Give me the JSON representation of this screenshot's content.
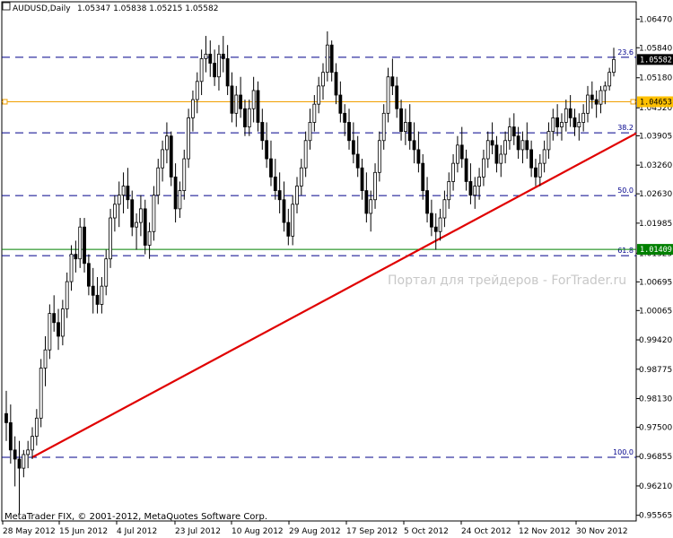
{
  "header": {
    "symbol": "AUDUSD,Daily",
    "ohlc": "1.05347 1.05838 1.05215 1.05582"
  },
  "watermark": "Портал для трейдеров - ForTrader.ru",
  "copyright": "MetaTrader FIX, © 2001-2012, MetaQuotes Software Corp.",
  "colors": {
    "background": "#ffffff",
    "candles": "#000000",
    "fib_lines": "#00008b",
    "trendline": "#e00000",
    "orange_line": "#f0a000",
    "green_line": "#008000"
  },
  "chart_data": {
    "type": "candlestick",
    "symbol": "AUDUSD",
    "timeframe": "Daily",
    "last_bar": {
      "open": 1.05347,
      "high": 1.05838,
      "low": 1.05215,
      "close": 1.05582
    },
    "ylim": [
      0.9544,
      1.0685
    ],
    "y_ticks": [
      "1.06470",
      "1.05840",
      "1.05180",
      "1.04520",
      "1.03905",
      "1.03260",
      "1.02630",
      "1.01985",
      "1.01325",
      "1.00695",
      "1.00065",
      "0.99420",
      "0.98775",
      "0.98130",
      "0.97500",
      "0.96855",
      "0.96210",
      "0.95565"
    ],
    "x_ticks": [
      "28 May 2012",
      "15 Jun 2012",
      "4 Jul 2012",
      "23 Jul 2012",
      "10 Aug 2012",
      "29 Aug 2012",
      "17 Sep 2012",
      "5 Oct 2012",
      "24 Oct 2012",
      "12 Nov 2012",
      "30 Nov 2012"
    ],
    "fib_levels": [
      {
        "label": "23.6",
        "price": 1.0563
      },
      {
        "label": "38.2",
        "price": 1.0397
      },
      {
        "label": "50.0",
        "price": 1.0259
      },
      {
        "label": "61.8",
        "price": 1.0127
      },
      {
        "label": "100.0",
        "price": 0.9684
      }
    ],
    "price_lines": [
      {
        "price": 1.04653,
        "label": "1.04653",
        "color": "#f0a000",
        "badge_bg": "#ffc000"
      },
      {
        "price": 1.01409,
        "label": "1.01409",
        "color": "#008000",
        "badge_bg": "#008000"
      },
      {
        "price": 1.05582,
        "label": "1.05582",
        "color": "#000000",
        "badge_bg": "#000000"
      }
    ],
    "trendline": {
      "from": {
        "bar": 6,
        "price": 0.9684
      },
      "to": {
        "bar": 144,
        "price": 1.039
      }
    },
    "bars": [
      [
        0.978,
        0.983,
        0.972,
        0.976
      ],
      [
        0.976,
        0.98,
        0.967,
        0.97
      ],
      [
        0.97,
        0.973,
        0.962,
        0.968
      ],
      [
        0.968,
        0.972,
        0.956,
        0.966
      ],
      [
        0.966,
        0.97,
        0.964,
        0.969
      ],
      [
        0.969,
        0.972,
        0.966,
        0.97
      ],
      [
        0.97,
        0.975,
        0.968,
        0.973
      ],
      [
        0.973,
        0.979,
        0.971,
        0.977
      ],
      [
        0.977,
        0.99,
        0.975,
        0.988
      ],
      [
        0.988,
        0.995,
        0.984,
        0.992
      ],
      [
        0.992,
        1.002,
        0.99,
        1.0
      ],
      [
        1.0,
        1.004,
        0.996,
        0.998
      ],
      [
        0.998,
        1.001,
        0.992,
        0.995
      ],
      [
        0.995,
        1.003,
        0.993,
        1.001
      ],
      [
        1.001,
        1.009,
        0.999,
        1.007
      ],
      [
        1.007,
        1.015,
        1.005,
        1.013
      ],
      [
        1.013,
        1.016,
        1.009,
        1.012
      ],
      [
        1.012,
        1.021,
        1.01,
        1.019
      ],
      [
        1.019,
        1.021,
        1.009,
        1.011
      ],
      [
        1.011,
        1.013,
        1.004,
        1.006
      ],
      [
        1.006,
        1.01,
        1.0,
        1.004
      ],
      [
        1.004,
        1.008,
        1.0,
        1.002
      ],
      [
        1.002,
        1.008,
        1.0,
        1.006
      ],
      [
        1.006,
        1.014,
        1.004,
        1.012
      ],
      [
        1.012,
        1.023,
        1.01,
        1.021
      ],
      [
        1.021,
        1.026,
        1.018,
        1.024
      ],
      [
        1.024,
        1.029,
        1.019,
        1.026
      ],
      [
        1.026,
        1.031,
        1.022,
        1.028
      ],
      [
        1.028,
        1.032,
        1.023,
        1.025
      ],
      [
        1.025,
        1.027,
        1.017,
        1.019
      ],
      [
        1.019,
        1.022,
        1.014,
        1.02
      ],
      [
        1.02,
        1.026,
        1.017,
        1.023
      ],
      [
        1.023,
        1.025,
        1.013,
        1.015
      ],
      [
        1.015,
        1.02,
        1.012,
        1.018
      ],
      [
        1.018,
        1.028,
        1.016,
        1.026
      ],
      [
        1.026,
        1.034,
        1.024,
        1.032
      ],
      [
        1.032,
        1.038,
        1.029,
        1.036
      ],
      [
        1.036,
        1.042,
        1.033,
        1.039
      ],
      [
        1.039,
        1.04,
        1.028,
        1.03
      ],
      [
        1.03,
        1.033,
        1.02,
        1.023
      ],
      [
        1.023,
        1.029,
        1.021,
        1.027
      ],
      [
        1.027,
        1.036,
        1.025,
        1.034
      ],
      [
        1.034,
        1.045,
        1.032,
        1.043
      ],
      [
        1.043,
        1.049,
        1.04,
        1.047
      ],
      [
        1.047,
        1.053,
        1.044,
        1.051
      ],
      [
        1.051,
        1.058,
        1.048,
        1.056
      ],
      [
        1.056,
        1.061,
        1.053,
        1.057
      ],
      [
        1.057,
        1.06,
        1.052,
        1.055
      ],
      [
        1.055,
        1.058,
        1.05,
        1.052
      ],
      [
        1.052,
        1.059,
        1.049,
        1.057
      ],
      [
        1.057,
        1.061,
        1.053,
        1.056
      ],
      [
        1.056,
        1.059,
        1.048,
        1.05
      ],
      [
        1.05,
        1.053,
        1.042,
        1.044
      ],
      [
        1.044,
        1.05,
        1.041,
        1.048
      ],
      [
        1.048,
        1.052,
        1.043,
        1.045
      ],
      [
        1.045,
        1.047,
        1.039,
        1.041
      ],
      [
        1.041,
        1.047,
        1.039,
        1.045
      ],
      [
        1.045,
        1.052,
        1.042,
        1.049
      ],
      [
        1.049,
        1.051,
        1.04,
        1.042
      ],
      [
        1.042,
        1.045,
        1.036,
        1.038
      ],
      [
        1.038,
        1.042,
        1.032,
        1.034
      ],
      [
        1.034,
        1.038,
        1.028,
        1.03
      ],
      [
        1.03,
        1.034,
        1.025,
        1.027
      ],
      [
        1.027,
        1.031,
        1.022,
        1.025
      ],
      [
        1.025,
        1.029,
        1.018,
        1.02
      ],
      [
        1.02,
        1.023,
        1.015,
        1.017
      ],
      [
        1.017,
        1.026,
        1.015,
        1.024
      ],
      [
        1.024,
        1.03,
        1.022,
        1.028
      ],
      [
        1.028,
        1.034,
        1.026,
        1.032
      ],
      [
        1.032,
        1.04,
        1.03,
        1.038
      ],
      [
        1.038,
        1.045,
        1.036,
        1.042
      ],
      [
        1.042,
        1.048,
        1.04,
        1.046
      ],
      [
        1.046,
        1.052,
        1.044,
        1.05
      ],
      [
        1.05,
        1.055,
        1.047,
        1.053
      ],
      [
        1.053,
        1.062,
        1.051,
        1.059
      ],
      [
        1.059,
        1.06,
        1.051,
        1.053
      ],
      [
        1.053,
        1.055,
        1.046,
        1.048
      ],
      [
        1.048,
        1.051,
        1.042,
        1.044
      ],
      [
        1.044,
        1.046,
        1.039,
        1.042
      ],
      [
        1.042,
        1.045,
        1.036,
        1.038
      ],
      [
        1.038,
        1.042,
        1.033,
        1.035
      ],
      [
        1.035,
        1.039,
        1.03,
        1.032
      ],
      [
        1.032,
        1.034,
        1.025,
        1.027
      ],
      [
        1.027,
        1.031,
        1.02,
        1.022
      ],
      [
        1.022,
        1.027,
        1.018,
        1.025
      ],
      [
        1.025,
        1.033,
        1.023,
        1.031
      ],
      [
        1.031,
        1.04,
        1.029,
        1.038
      ],
      [
        1.038,
        1.046,
        1.036,
        1.044
      ],
      [
        1.044,
        1.054,
        1.042,
        1.052
      ],
      [
        1.052,
        1.056,
        1.048,
        1.05
      ],
      [
        1.05,
        1.052,
        1.043,
        1.045
      ],
      [
        1.045,
        1.047,
        1.038,
        1.04
      ],
      [
        1.04,
        1.045,
        1.037,
        1.042
      ],
      [
        1.042,
        1.046,
        1.036,
        1.038
      ],
      [
        1.038,
        1.042,
        1.033,
        1.036
      ],
      [
        1.036,
        1.04,
        1.031,
        1.033
      ],
      [
        1.033,
        1.035,
        1.025,
        1.027
      ],
      [
        1.027,
        1.03,
        1.02,
        1.022
      ],
      [
        1.022,
        1.025,
        1.017,
        1.019
      ],
      [
        1.019,
        1.022,
        1.014,
        1.018
      ],
      [
        1.018,
        1.023,
        1.016,
        1.021
      ],
      [
        1.021,
        1.027,
        1.019,
        1.025
      ],
      [
        1.025,
        1.031,
        1.023,
        1.029
      ],
      [
        1.029,
        1.035,
        1.027,
        1.033
      ],
      [
        1.033,
        1.039,
        1.031,
        1.037
      ],
      [
        1.037,
        1.041,
        1.032,
        1.034
      ],
      [
        1.034,
        1.036,
        1.027,
        1.029
      ],
      [
        1.029,
        1.033,
        1.024,
        1.026
      ],
      [
        1.026,
        1.03,
        1.023,
        1.028
      ],
      [
        1.028,
        1.032,
        1.025,
        1.03
      ],
      [
        1.03,
        1.036,
        1.028,
        1.034
      ],
      [
        1.034,
        1.04,
        1.032,
        1.038
      ],
      [
        1.038,
        1.042,
        1.035,
        1.037
      ],
      [
        1.037,
        1.039,
        1.031,
        1.033
      ],
      [
        1.033,
        1.037,
        1.03,
        1.035
      ],
      [
        1.035,
        1.04,
        1.033,
        1.038
      ],
      [
        1.038,
        1.043,
        1.036,
        1.041
      ],
      [
        1.041,
        1.044,
        1.037,
        1.039
      ],
      [
        1.039,
        1.041,
        1.034,
        1.036
      ],
      [
        1.036,
        1.04,
        1.033,
        1.038
      ],
      [
        1.038,
        1.042,
        1.034,
        1.036
      ],
      [
        1.036,
        1.038,
        1.03,
        1.032
      ],
      [
        1.032,
        1.034,
        1.028,
        1.03
      ],
      [
        1.03,
        1.035,
        1.028,
        1.033
      ],
      [
        1.033,
        1.038,
        1.031,
        1.036
      ],
      [
        1.036,
        1.042,
        1.034,
        1.04
      ],
      [
        1.04,
        1.045,
        1.038,
        1.043
      ],
      [
        1.043,
        1.046,
        1.039,
        1.041
      ],
      [
        1.041,
        1.044,
        1.038,
        1.042
      ],
      [
        1.042,
        1.047,
        1.04,
        1.045
      ],
      [
        1.045,
        1.048,
        1.041,
        1.043
      ],
      [
        1.043,
        1.045,
        1.039,
        1.041
      ],
      [
        1.041,
        1.044,
        1.038,
        1.042
      ],
      [
        1.042,
        1.046,
        1.04,
        1.044
      ],
      [
        1.044,
        1.05,
        1.042,
        1.048
      ],
      [
        1.048,
        1.051,
        1.045,
        1.047
      ],
      [
        1.047,
        1.049,
        1.043,
        1.046
      ],
      [
        1.046,
        1.05,
        1.044,
        1.049
      ],
      [
        1.049,
        1.051,
        1.046,
        1.05
      ],
      [
        1.05,
        1.054,
        1.049,
        1.053
      ],
      [
        1.053,
        1.0584,
        1.0521,
        1.05582
      ]
    ]
  }
}
